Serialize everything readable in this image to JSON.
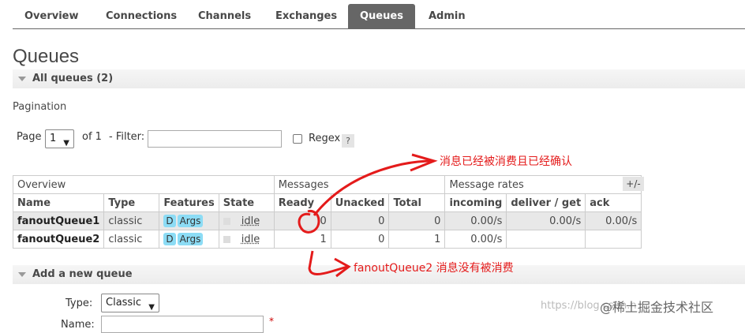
{
  "tabs": [
    "Overview",
    "Connections",
    "Channels",
    "Exchanges",
    "Queues",
    "Admin"
  ],
  "active_tab": "Queues",
  "page_title": "Queues",
  "all_queues": "All queues (2)",
  "pagination": {
    "label": "Pagination",
    "page_label": "Page",
    "page_value": "1",
    "of_label": "of 1",
    "filter_label": "- Filter:",
    "filter_value": "",
    "regex_label": "Regex",
    "help": "?"
  },
  "table": {
    "groups": [
      "Overview",
      "Messages",
      "Message rates"
    ],
    "plus_minus": "+/-",
    "columns": [
      "Name",
      "Type",
      "Features",
      "State",
      "Ready",
      "Unacked",
      "Total",
      "incoming",
      "deliver / get",
      "ack"
    ],
    "rows": [
      {
        "name": "fanoutQueue1",
        "type": "classic",
        "features": [
          "D",
          "Args"
        ],
        "state": "idle",
        "ready": "0",
        "unacked": "0",
        "total": "0",
        "incoming": "0.00/s",
        "deliver_get": "0.00/s",
        "ack": "0.00/s"
      },
      {
        "name": "fanoutQueue2",
        "type": "classic",
        "features": [
          "D",
          "Args"
        ],
        "state": "idle",
        "ready": "1",
        "unacked": "0",
        "total": "1",
        "incoming": "0.00/s",
        "deliver_get": "",
        "ack": ""
      }
    ]
  },
  "add_queue": {
    "header": "Add a new queue",
    "type_label": "Type:",
    "type_value": "Classic",
    "name_label": "Name:",
    "required_mark": "*"
  },
  "annotations": {
    "consumed": "消息已经被消费且已经确认",
    "not_consumed": "fanoutQueue2 消息没有被消费",
    "color": "#e41b1b"
  },
  "watermark": {
    "url": "https://blog.csdn.n",
    "brand": "@稀土掘金技术社区"
  }
}
